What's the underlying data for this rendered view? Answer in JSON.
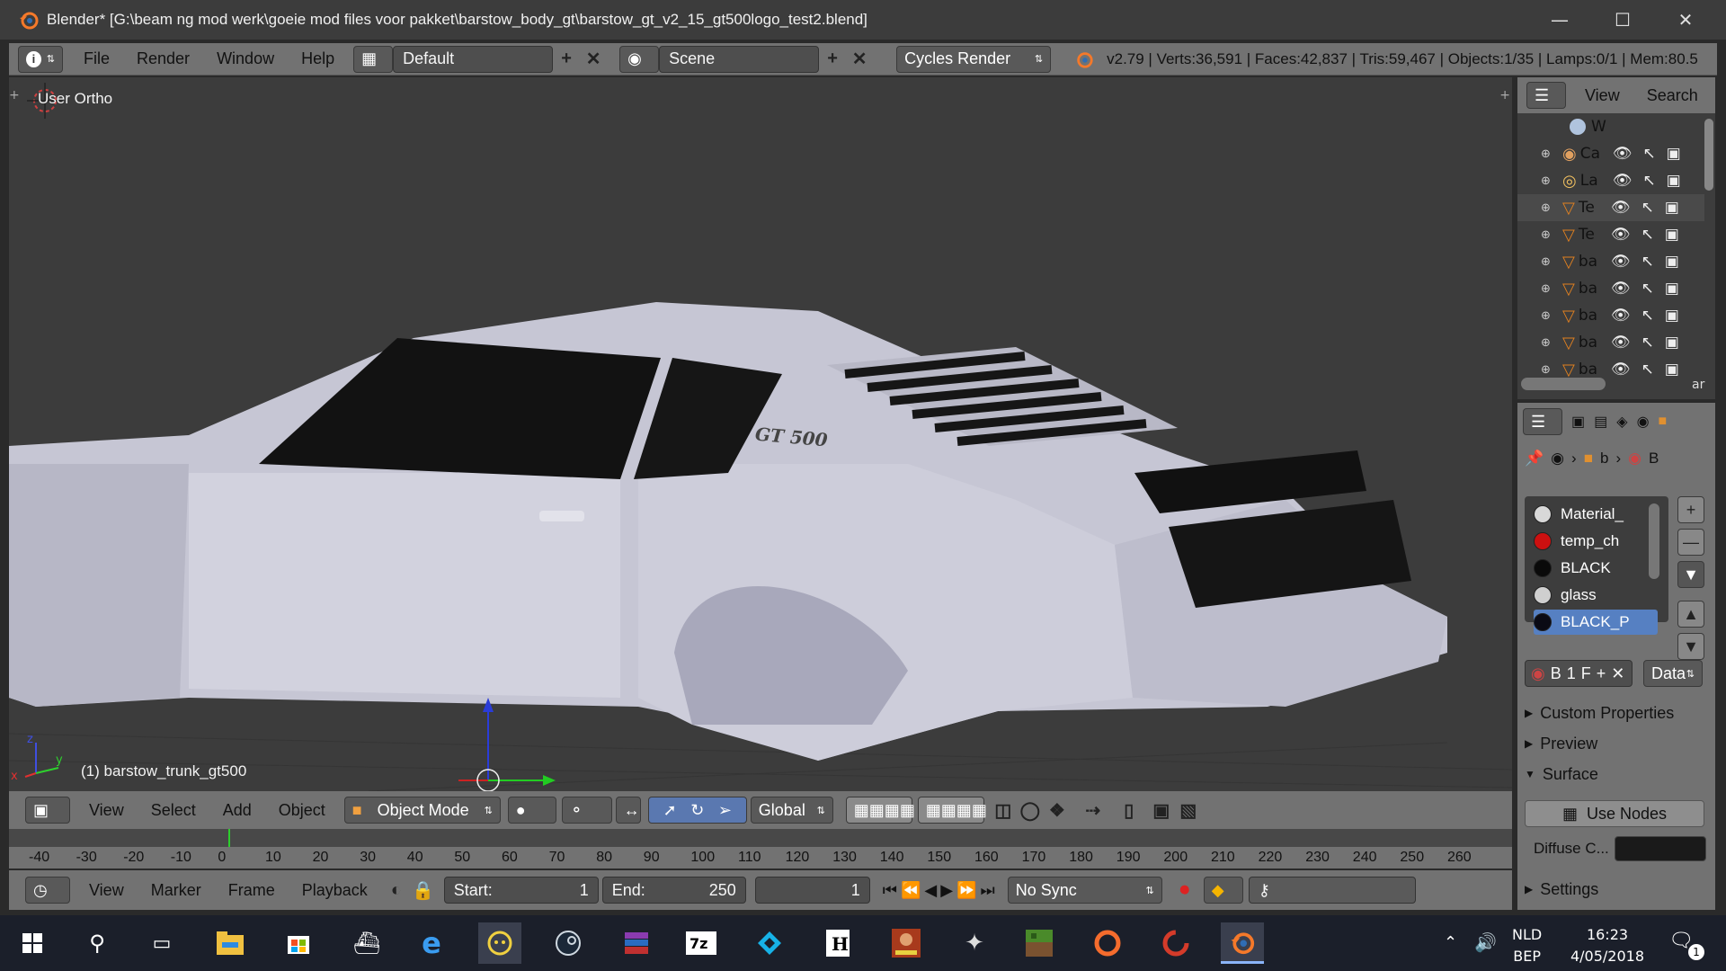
{
  "window": {
    "title": "Blender* [G:\\beam ng mod werk\\goeie mod files voor pakket\\barstow_body_gt\\barstow_gt_v2_15_gt500logo_test2.blend]"
  },
  "info_header": {
    "menus": [
      "File",
      "Render",
      "Window",
      "Help"
    ],
    "screen_layout": "Default",
    "scene": "Scene",
    "render_engine": "Cycles Render",
    "stats": "v2.79 | Verts:36,591 | Faces:42,837 | Tris:59,467 | Objects:1/35 | Lamps:0/1 | Mem:80.5"
  },
  "viewport": {
    "view_label": "User Ortho",
    "active_object": "(1) barstow_trunk_gt500",
    "decal_text": "GT 500",
    "axis_x": "x",
    "axis_y": "y",
    "axis_z": "z"
  },
  "view3d_header": {
    "menus": [
      "View",
      "Select",
      "Add",
      "Object"
    ],
    "mode": "Object Mode",
    "orientation": "Global"
  },
  "timeline": {
    "ruler_ticks": [
      "-40",
      "-30",
      "-20",
      "-10",
      "0",
      "10",
      "20",
      "30",
      "40",
      "50",
      "60",
      "70",
      "80",
      "90",
      "100",
      "110",
      "120",
      "130",
      "140",
      "150",
      "160",
      "170",
      "180",
      "190",
      "200",
      "210",
      "220",
      "230",
      "240",
      "250",
      "260"
    ],
    "menus": [
      "View",
      "Marker",
      "Frame",
      "Playback"
    ],
    "start_label": "Start:",
    "start_value": "1",
    "end_label": "End:",
    "end_value": "250",
    "current_frame": "1",
    "sync": "No Sync"
  },
  "outliner": {
    "header_view": "View",
    "header_search": "Search",
    "top_item": "W",
    "items": [
      {
        "label": "Ca",
        "icon": "camera-icon"
      },
      {
        "label": "La",
        "icon": "lamp-icon"
      },
      {
        "label": "Te",
        "icon": "mesh-icon"
      },
      {
        "label": "Te",
        "icon": "mesh-icon"
      },
      {
        "label": "ba",
        "icon": "mesh-icon"
      },
      {
        "label": "ba",
        "icon": "mesh-icon"
      },
      {
        "label": "ba",
        "icon": "mesh-icon"
      },
      {
        "label": "ba",
        "icon": "mesh-icon"
      },
      {
        "label": "ba",
        "icon": "mesh-icon"
      }
    ],
    "scroll_hint": "ar"
  },
  "properties": {
    "breadcrumb_object": "b",
    "breadcrumb_material": "B",
    "materials": [
      {
        "name": "Material_",
        "color": "#d8d8d8"
      },
      {
        "name": "temp_ch",
        "color": "#cc1010"
      },
      {
        "name": "BLACK",
        "color": "#0a0a0a"
      },
      {
        "name": "glass",
        "color": "#cfcfcf"
      },
      {
        "name": "BLACK_P",
        "color": "#0a0a14"
      }
    ],
    "selected_material": "BLACK_P",
    "slot_name": "B",
    "users": "1",
    "fake_user": "F",
    "link": "Data",
    "panels": [
      "Custom Properties",
      "Preview",
      "Surface"
    ],
    "use_nodes": "Use Nodes",
    "diffuse_label": "Diffuse C...",
    "settings_panel": "Settings"
  },
  "taskbar": {
    "language": "NLD",
    "keyboard": "BEP",
    "time": "16:23",
    "date": "4/05/2018",
    "notification_count": "1"
  }
}
